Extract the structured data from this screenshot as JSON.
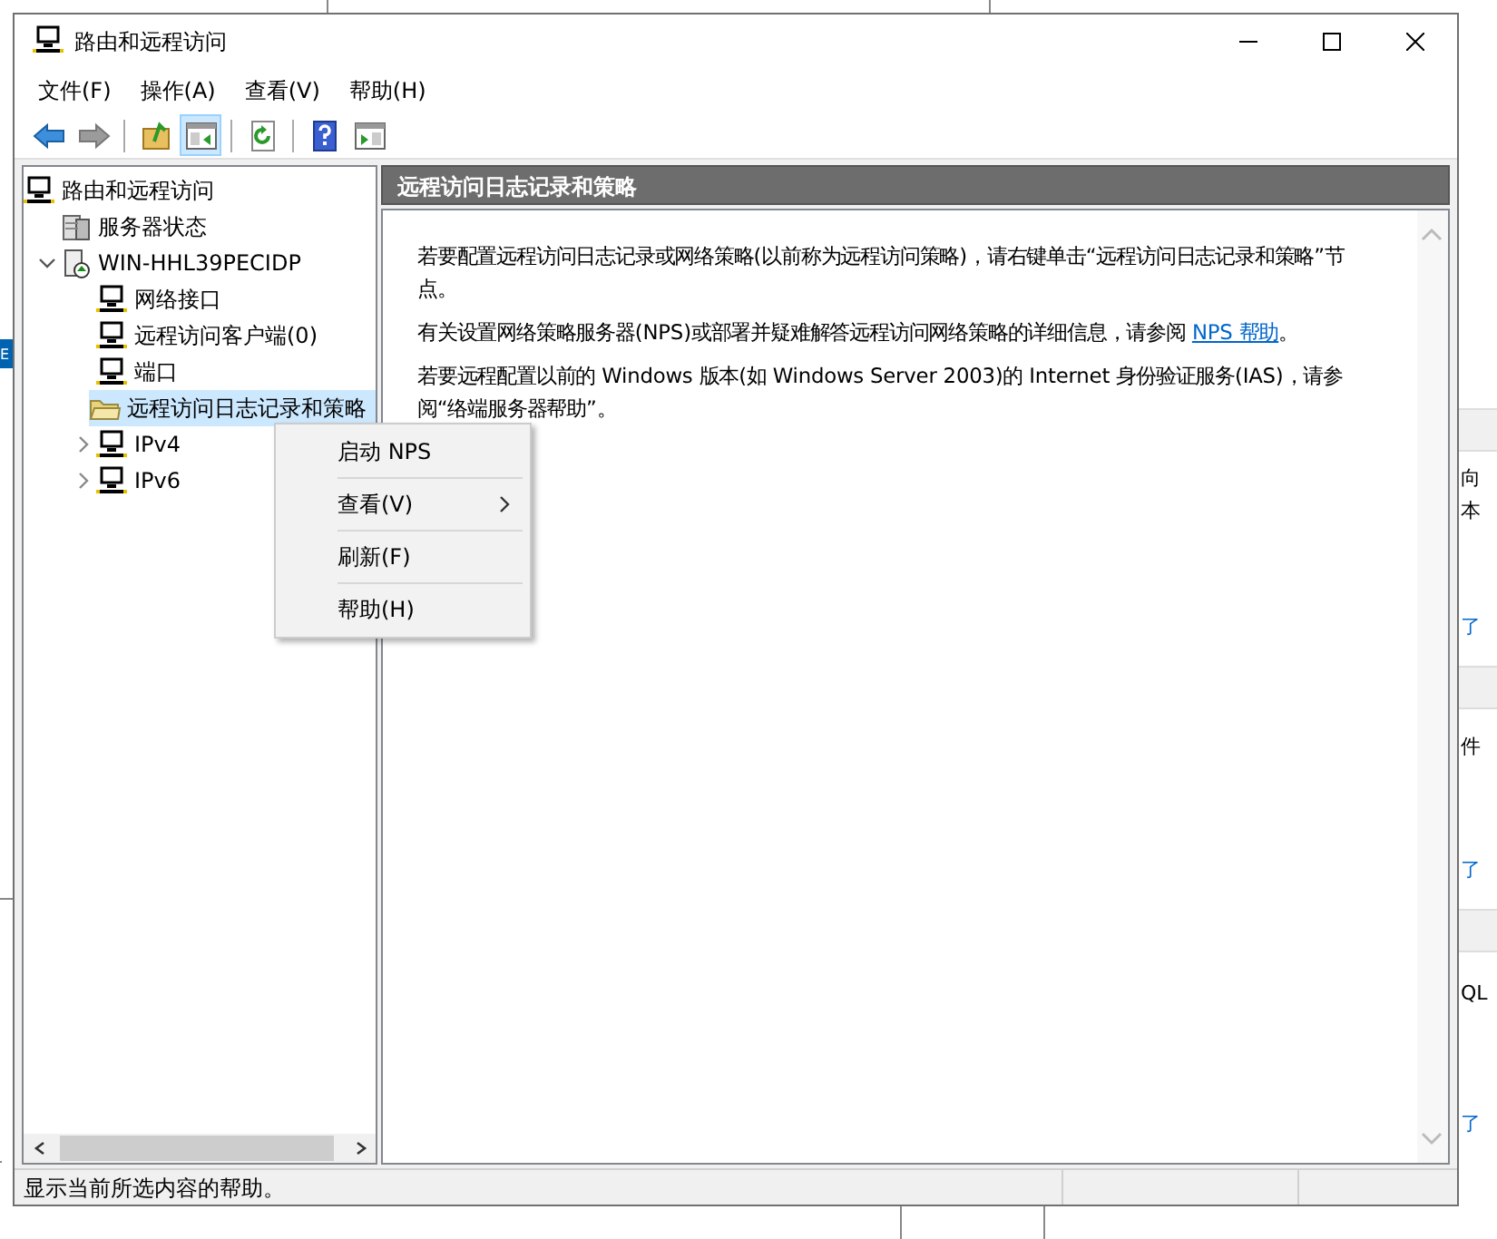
{
  "window": {
    "title": "路由和远程访问"
  },
  "menu": [
    "文件(F)",
    "操作(A)",
    "查看(V)",
    "帮助(H)"
  ],
  "toolbar": [
    {
      "kind": "back",
      "disabled": false,
      "pressed": false
    },
    {
      "kind": "forward",
      "disabled": true,
      "pressed": false
    },
    {
      "kind": "up",
      "disabled": false,
      "pressed": false
    },
    {
      "kind": "tree",
      "disabled": false,
      "pressed": true
    },
    {
      "kind": "refresh",
      "disabled": false,
      "pressed": false
    },
    {
      "kind": "help",
      "disabled": false,
      "pressed": false
    },
    {
      "kind": "pane",
      "disabled": false,
      "pressed": false
    }
  ],
  "tree": [
    {
      "label": "路由和远程访问",
      "kind": "computer",
      "selected": false,
      "children": [
        {
          "label": "服务器状态",
          "kind": "server",
          "selected": false
        },
        {
          "label": "WIN-HHL39PECIDP",
          "kind": "servernode",
          "selected": false,
          "expanded": true,
          "children": [
            {
              "label": "网络接口",
              "kind": "computer",
              "selected": false
            },
            {
              "label": "远程访问客户端(0)",
              "kind": "computer",
              "selected": false
            },
            {
              "label": "端口",
              "kind": "computer",
              "selected": false
            },
            {
              "label": "远程访问日志记录和策略",
              "kind": "folder",
              "selected": true
            },
            {
              "label": "IPv4",
              "kind": "computer",
              "selected": false,
              "expanded": false
            },
            {
              "label": "IPv6",
              "kind": "computer",
              "selected": false,
              "expanded": false
            }
          ]
        }
      ]
    }
  ],
  "content": {
    "title": "远程访问日志记录和策略",
    "paragraphs": [
      [
        {
          "text": "若要配置远程访问日志记录或网络策略(以前称为远程访问策略)，请右键单击“远程访问日志记录和策略”节点。"
        }
      ],
      [
        {
          "text": "有关设置网络策略服务器(NPS)或部署并疑难解答远程访问网络策略的详细信息，请参阅 "
        },
        {
          "text": "NPS 帮助",
          "link": true
        },
        {
          "text": "。"
        }
      ],
      [
        {
          "text": "若要远程配置以前的 Windows 版本(如 Windows Server 2003)的 Internet 身份验证服务(IAS)，请参阅“络端服务器帮助”。"
        }
      ]
    ]
  },
  "context_menu": [
    {
      "label": "启动 NPS",
      "submenu": false
    },
    {
      "label": "查看(V)",
      "submenu": true
    },
    {
      "label": "刷新(F)",
      "submenu": false
    },
    {
      "label": "帮助(H)",
      "submenu": false
    }
  ],
  "status_bar": {
    "text": "显示当前所选内容的帮助。"
  },
  "background": {
    "left_fragment": "E",
    "right_fragments": [
      {
        "text": "向",
        "link": false
      },
      {
        "text": "本",
        "link": false
      },
      {
        "text": "了",
        "link": true
      },
      {
        "text": "件",
        "link": false
      },
      {
        "text": "了",
        "link": true
      },
      {
        "text": "QL",
        "link": false
      },
      {
        "text": "了",
        "link": true
      }
    ]
  }
}
